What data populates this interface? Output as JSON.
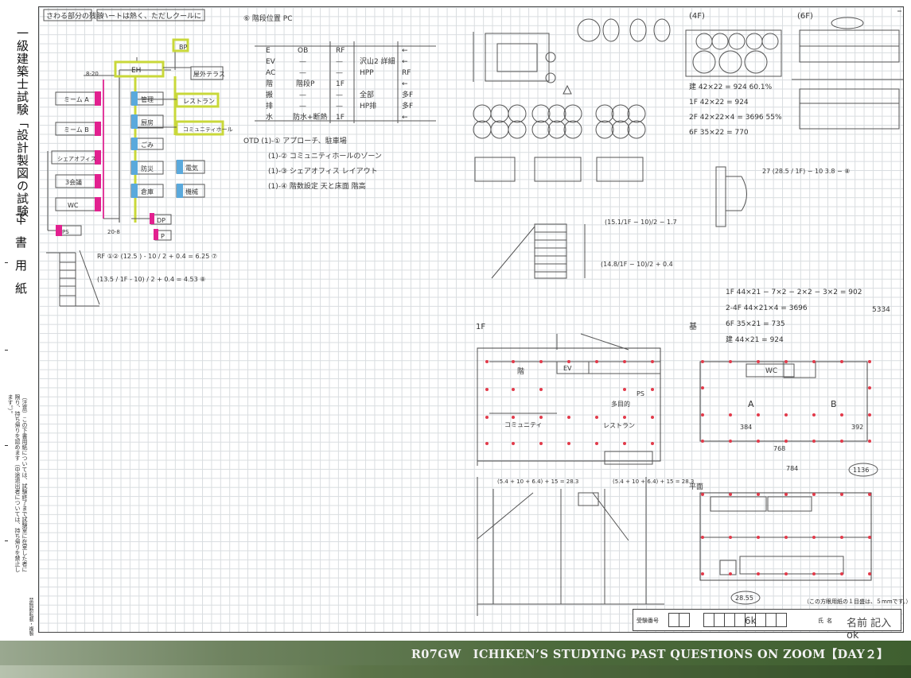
{
  "left_margin": {
    "title": "一級建築士試験「設計製図の試験」",
    "subtitle": "下書用紙",
    "note": "（注意）この下書用紙については、試験終了まで試験室に在室した者に限り、持ち帰りを認めます（中途退出者については、持ち帰りを禁止します。）。",
    "note2": "禁無断転載・複製"
  },
  "sheet": {
    "header_note_1": "さわる部分の残骸",
    "header_note_2": "ハートは熱く、ただしクールに",
    "handwriting": {
      "zoning_title": "⑥ 階段位置 PC",
      "table_header": [
        "E",
        "OB",
        "RF",
        "←"
      ],
      "table_rows": [
        [
          "EV",
          "—",
          "—",
          "沢山2 詳細",
          "←"
        ],
        [
          "AC",
          "—",
          "—",
          "HPP",
          "RF"
        ],
        [
          "階",
          "階段P",
          "1F",
          "←"
        ],
        [
          "搬",
          "—",
          "—",
          "全部",
          "多F"
        ],
        [
          "排",
          "—",
          "—",
          "HP排",
          "多F"
        ],
        [
          "水",
          "防水+断熱",
          "1F",
          "←"
        ]
      ],
      "notes": [
        "OTD (1)-① アプローチ、駐車場",
        "(1)-② コミュニティホールのゾーン",
        "(1)-③ シェアオフィス レイアウト",
        "(1)-④ 階数設定 天と床面 階高"
      ],
      "diagram_nodes": {
        "top": "BP",
        "eh": "EH",
        "terrace": "屋外テラス",
        "admin": "管理",
        "restaurant": "レストラン",
        "kitchen": "厨房",
        "community": "コミュニティホール",
        "office_a": "ミーム A",
        "office_b": "ミーム B",
        "share_office": "シェアオフィス",
        "meeting": "3会議",
        "wc": "WC",
        "trash": "ごみ",
        "disaster": "防災",
        "storage": "倉庫",
        "ev_room": "電気",
        "mech": "機械",
        "dp": "DP",
        "p": "P",
        "pipe": "PS",
        "level_a": "8-20",
        "level_b": "20-8"
      },
      "calc_1": "RF ①② (12.5 ) - 10 / 2 + 0.4 = 6.25 ⑦",
      "calc_2": "(13.5 / 1F - 10) / 2 + 0.4 = 4.53 ⑧",
      "area_calc": [
        "建 42×22 = 924   60.1%",
        "1F 42×22 = 924",
        "2F 42×22×4 = 3696   55%",
        "6F 35×22 = 770"
      ],
      "area_calc_2": [
        "1F 44×21 − 7×2 − 2×2 − 3×2 = 902",
        "2-4F 44×21×4 = 3696",
        "6F 35×21 = 735",
        "建 44×21 = 924"
      ],
      "area_total": "5334",
      "stair_calc_1": "(15.1/1F − 10)/2 − 1.7",
      "stair_calc_2": "(14.8/1F − 10)/2 + 0.4",
      "stair_calc_3": "27 (28.5 / 1F) − 10  3.8 − ⑧",
      "floor_labels": [
        "1F",
        "基",
        "(4F)",
        "(6F)",
        "平面"
      ],
      "plan_rooms": [
        "WC",
        "A",
        "B",
        "EV",
        "階",
        "PS",
        "多目的",
        "コミュニティ",
        "レストラン"
      ],
      "sum_labels": [
        "384",
        "392",
        "768",
        "784",
        "1136",
        "28.55"
      ],
      "section_calc_1": "(5.4 + 10 + 6.4) + 15 = 28.3",
      "section_calc_2": "(5.4 + 10 + 6.4) + 15 = 28.3"
    }
  },
  "title_block": {
    "exam_label": "受験番号",
    "exam_value": "6k",
    "name_label": "氏名",
    "name_value": "名前 記入 ok"
  },
  "scale_note": "（この方眼用紙の１目盛は、５mmです。）",
  "footer": {
    "text": "R07GW　ICHIKEN’S STUDYING PAST QUESTIONS ON ZOOM【DAY２】"
  }
}
